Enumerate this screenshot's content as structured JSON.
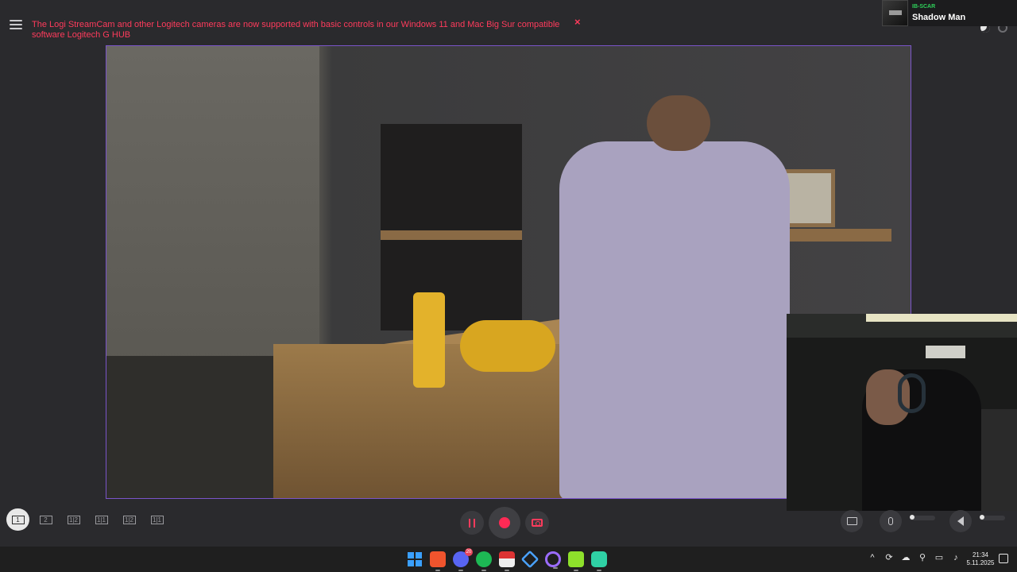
{
  "notice": {
    "text": "The Logi StreamCam and other Logitech cameras are now supported with basic controls in our Windows 11 and Mac Big Sur compatible software Logitech G HUB",
    "close_glyph": "×",
    "color": "#ff3b5c"
  },
  "media": {
    "tag": "IB-SCAR",
    "title": "Shadow Man"
  },
  "layouts": [
    {
      "label": "1",
      "active": true
    },
    {
      "label": "2",
      "active": false
    },
    {
      "label": "1|2",
      "active": false
    },
    {
      "label": "1|1",
      "active": false
    },
    {
      "label": "1|2",
      "active": false
    },
    {
      "label": "1|1",
      "active": false
    }
  ],
  "controls": {
    "pause_icon": "pause-icon",
    "record_icon": "record-icon",
    "snapshot_icon": "camera-icon",
    "accent": "#ff2a55"
  },
  "taskbar": {
    "apps": [
      "windows-start",
      "brave",
      "discord",
      "spotify",
      "news",
      "app-blue",
      "app-purple",
      "app-green",
      "app-teal"
    ],
    "discord_badge": "20",
    "time": "21:34",
    "date": "5.11.2025"
  },
  "colors": {
    "preview_border": "#7a54c9",
    "background": "#2a2a2d"
  }
}
